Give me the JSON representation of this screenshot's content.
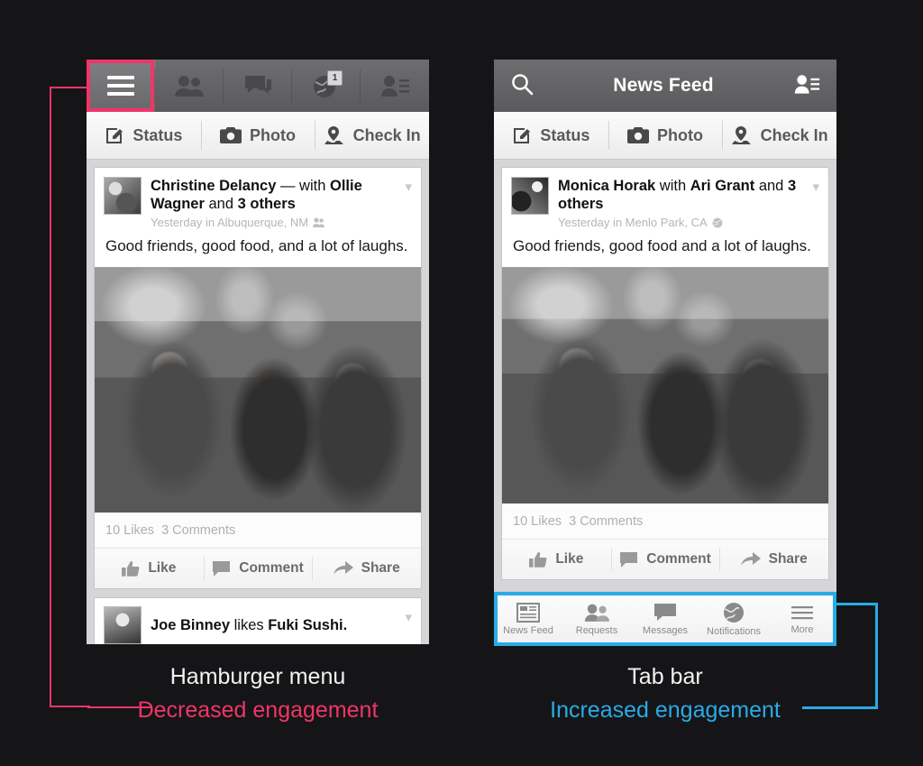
{
  "theme": {
    "background": "#151517",
    "accent_red": "#F0356A",
    "accent_blue": "#29ABE8"
  },
  "left_phone": {
    "nav": {
      "items": [
        {
          "name": "hamburger-menu",
          "icon": "hamburger-icon",
          "label": ""
        },
        {
          "name": "friend-requests",
          "icon": "friends-icon",
          "label": ""
        },
        {
          "name": "messages",
          "icon": "messages-icon",
          "label": ""
        },
        {
          "name": "notifications",
          "icon": "globe-icon",
          "label": "",
          "badge": "1"
        },
        {
          "name": "friend-list",
          "icon": "friend-list-icon",
          "label": ""
        }
      ],
      "highlighted": "hamburger-menu"
    },
    "composer": {
      "status_label": "Status",
      "photo_label": "Photo",
      "checkin_label": "Check In"
    },
    "posts": [
      {
        "names_html_parts": {
          "author": "Christine Delancy",
          "connector": " — with ",
          "tagged": "Ollie Wagner",
          "and": " and ",
          "others": "3 others"
        },
        "meta": "Yesterday in Albuquerque, NM",
        "meta_icon": "friends-privacy-icon",
        "text": "Good friends, good food, and a lot of laughs.",
        "likes": "10 Likes",
        "comments": "3 Comments",
        "actions": {
          "like": "Like",
          "comment": "Comment",
          "share": "Share"
        }
      },
      {
        "text_parts": {
          "author": "Joe Binney",
          "verb": " likes ",
          "object": "Fuki Sushi."
        }
      }
    ]
  },
  "right_phone": {
    "nav": {
      "search_icon": "search-icon",
      "title": "News Feed",
      "friend_list_icon": "friend-list-icon"
    },
    "composer": {
      "status_label": "Status",
      "photo_label": "Photo",
      "checkin_label": "Check In"
    },
    "posts": [
      {
        "names_html_parts": {
          "author": "Monica Horak",
          "connector": " with ",
          "tagged": "Ari Grant",
          "and": " and ",
          "others": "3 others"
        },
        "meta": "Yesterday in Menlo Park, CA",
        "meta_icon": "globe-privacy-icon",
        "text": "Good friends, good food and a lot of laughs.",
        "likes": "10 Likes",
        "comments": "3 Comments",
        "actions": {
          "like": "Like",
          "comment": "Comment",
          "share": "Share"
        }
      }
    ],
    "tabbar": {
      "items": [
        {
          "label": "News Feed",
          "icon": "newsfeed-icon"
        },
        {
          "label": "Requests",
          "icon": "friends-icon"
        },
        {
          "label": "Messages",
          "icon": "messages-icon"
        },
        {
          "label": "Notifications",
          "icon": "globe-icon"
        },
        {
          "label": "More",
          "icon": "hamburger-icon"
        }
      ],
      "highlighted": true
    }
  },
  "captions": {
    "left": {
      "title": "Hamburger menu",
      "subtitle": "Decreased engagement"
    },
    "right": {
      "title": "Tab bar",
      "subtitle": "Increased engagement"
    }
  }
}
